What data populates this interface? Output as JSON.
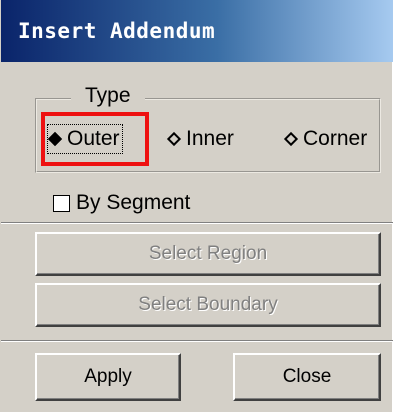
{
  "window": {
    "title": "Insert Addendum"
  },
  "type_group": {
    "legend": "Type",
    "options": [
      {
        "label": "Outer",
        "selected": true
      },
      {
        "label": "Inner",
        "selected": false
      },
      {
        "label": "Corner",
        "selected": false
      }
    ]
  },
  "by_segment": {
    "label": "By Segment",
    "checked": false
  },
  "buttons": {
    "select_region": "Select Region",
    "select_boundary": "Select Boundary",
    "apply": "Apply",
    "close": "Close"
  },
  "colors": {
    "title_gradient_start": "#0a246a",
    "title_gradient_end": "#a6caf0",
    "face": "#d4d0c8",
    "highlight_box": "#ee1111",
    "disabled_text": "#808080"
  }
}
